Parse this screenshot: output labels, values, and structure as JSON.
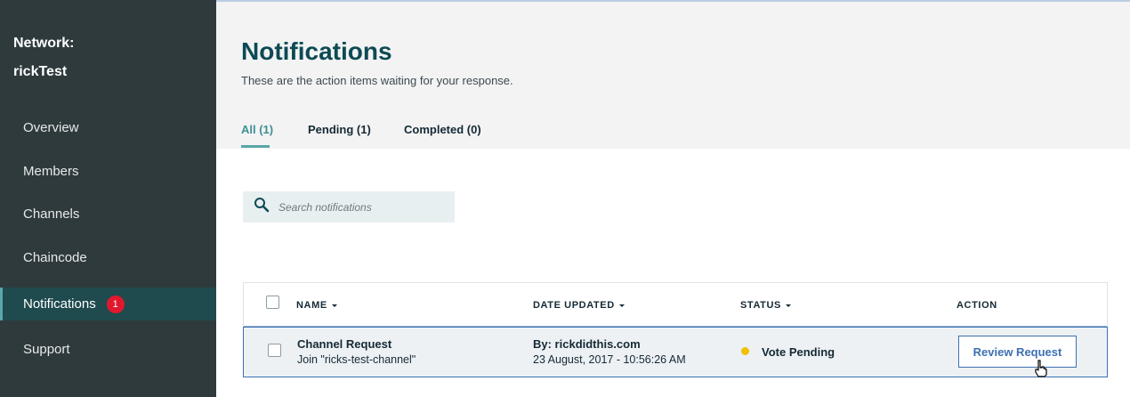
{
  "sidebar": {
    "network_label": "Network:",
    "network_name": "rickTest",
    "items": [
      {
        "label": "Overview"
      },
      {
        "label": "Members"
      },
      {
        "label": "Channels"
      },
      {
        "label": "Chaincode"
      },
      {
        "label": "Notifications",
        "badge": "1",
        "active": true
      },
      {
        "label": "Support"
      }
    ]
  },
  "header": {
    "title": "Notifications",
    "subtitle": "These are the action items waiting for your response.",
    "tabs": [
      {
        "label": "All (1)",
        "active": true
      },
      {
        "label": "Pending (1)"
      },
      {
        "label": "Completed (0)"
      }
    ]
  },
  "search": {
    "placeholder": "Search notifications"
  },
  "table": {
    "columns": [
      "NAME",
      "DATE UPDATED",
      "STATUS",
      "ACTION"
    ],
    "rows": [
      {
        "name": "Channel Request",
        "detail": "Join \"ricks-test-channel\"",
        "by": "By: rickdidthis.com",
        "date": "23 August, 2017 - 10:56:26 AM",
        "status": "Vote Pending",
        "action": "Review Request"
      }
    ]
  },
  "colors": {
    "sidebar_bg": "#2f3a3d",
    "active_nav_bg": "#1f4a4e",
    "accent": "#5aa7a8",
    "badge": "#e0182d",
    "status_pending": "#efc100",
    "primary": "#3d70b2"
  },
  "icons": {
    "search": "search-icon",
    "sort": "caret-down-icon",
    "status": "status-dot-icon",
    "cursor": "hand-pointer-icon"
  }
}
